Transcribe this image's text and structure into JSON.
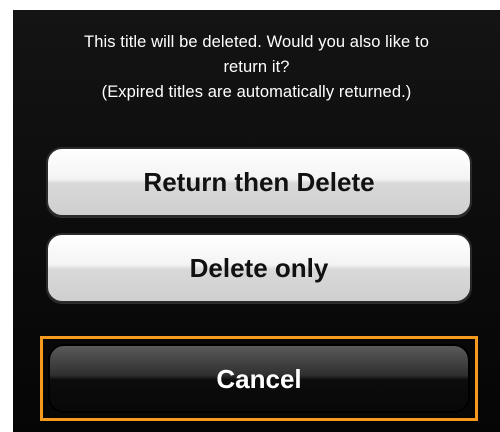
{
  "dialog": {
    "message_lines": [
      "This title will be deleted.  Would you also like to",
      "return it?",
      "(Expired titles are automatically returned.)"
    ]
  },
  "buttons": {
    "return_then_delete": "Return then Delete",
    "delete_only": "Delete only",
    "cancel": "Cancel"
  },
  "colors": {
    "sheet_background": "#0a0a0a",
    "highlight": "#f59a1f",
    "light_button": "#e6e6e6",
    "dark_button": "#1a1a1a"
  }
}
